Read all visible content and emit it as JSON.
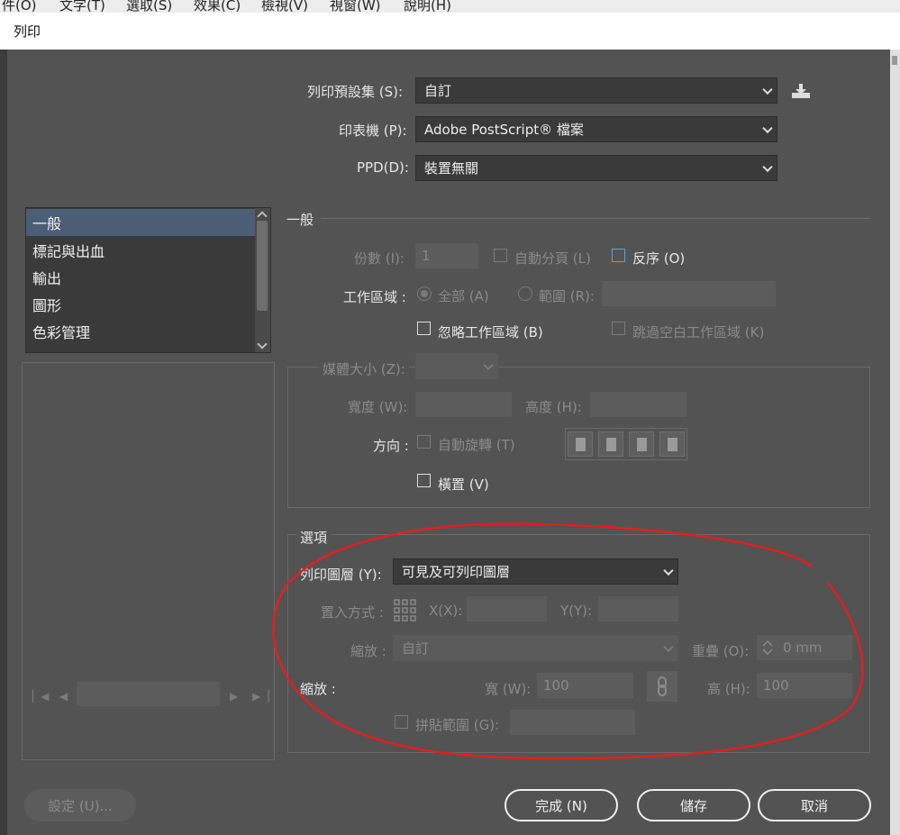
{
  "menubar": {
    "items": [
      "件(O)",
      "文字(T)",
      "選取(S)",
      "效果(C)",
      "檢視(V)",
      "視窗(W)",
      "說明(H)"
    ]
  },
  "dialog": {
    "title": "列印"
  },
  "top": {
    "preset_label": "列印預設集 (S):",
    "preset_value": "自訂",
    "printer_label": "印表機 (P):",
    "printer_value": "Adobe PostScript® 檔案",
    "ppd_label": "PPD(D):",
    "ppd_value": "裝置無關",
    "save_preset_icon": "download-icon"
  },
  "sidebar": {
    "items": [
      {
        "label": "一般",
        "selected": true
      },
      {
        "label": "標記與出血",
        "selected": false
      },
      {
        "label": "輸出",
        "selected": false
      },
      {
        "label": "圖形",
        "selected": false
      },
      {
        "label": "色彩管理",
        "selected": false
      }
    ]
  },
  "general": {
    "heading": "一般",
    "copies_label": "份數 (I):",
    "copies_value": "1",
    "collate_label": "自動分頁 (L)",
    "reverse_label": "反序 (O)",
    "artboards_label": "工作區域 :",
    "all_label": "全部 (A)",
    "range_label": "範圍 (R):",
    "ignore_artboards_label": "忽略工作區域 (B)",
    "skip_blank_label": "跳過空白工作區域 (K)"
  },
  "media": {
    "size_label": "媒體大小 (Z):",
    "width_label": "寬度 (W):",
    "height_label": "高度 (H):",
    "orientation_label": "方向 :",
    "auto_rotate_label": "自動旋轉 (T)",
    "transverse_label": "橫置 (V)"
  },
  "options": {
    "heading": "選項",
    "print_layers_label": "列印圖層 (Y):",
    "print_layers_value": "可見及可列印圖層",
    "placement_label": "置入方式 :",
    "x_label": "X(X):",
    "y_label": "Y(Y):",
    "scaling_label": "縮放 :",
    "scaling_value": "自訂",
    "overlap_label": "重疊 (O):",
    "overlap_value": "0 mm",
    "scale_label": "縮放 :",
    "scale_w_label": "寬 (W):",
    "scale_w_value": "100",
    "scale_h_label": "高 (H):",
    "scale_h_value": "100",
    "tile_range_label": "拼貼範圍 (G):"
  },
  "buttons": {
    "setup": "設定 (U)...",
    "done": "完成 (N)",
    "save": "儲存",
    "cancel": "取消"
  },
  "colors": {
    "annotation": "#e02020",
    "selection": "#4b5e76",
    "accent_checkbox": "#5aa0e6"
  }
}
